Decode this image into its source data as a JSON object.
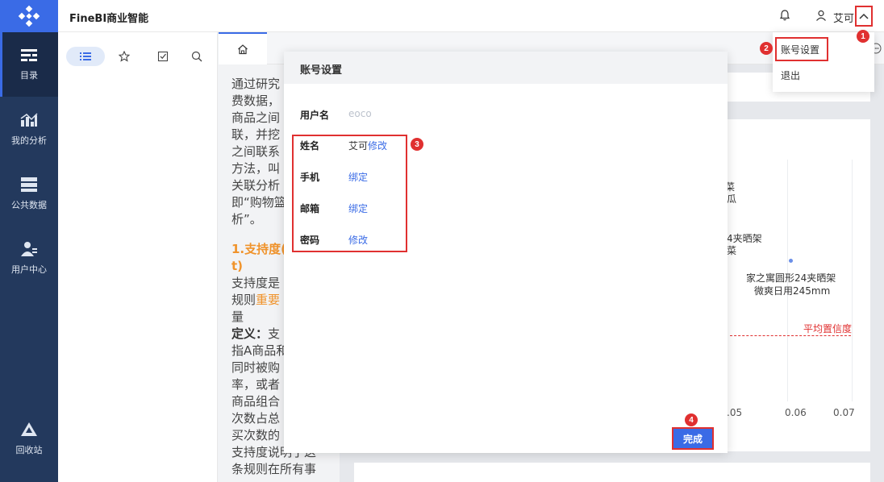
{
  "app": {
    "title": "FineBI商业智能"
  },
  "header": {
    "user_name": "艾可"
  },
  "nav": {
    "items": [
      {
        "label": "目录",
        "icon": "catalog-icon"
      },
      {
        "label": "我的分析",
        "icon": "my-analysis-icon"
      },
      {
        "label": "公共数据",
        "icon": "public-data-icon"
      },
      {
        "label": "用户中心",
        "icon": "user-center-icon"
      },
      {
        "label": "回收站",
        "icon": "recycle-bin-icon"
      }
    ]
  },
  "dropdown": {
    "items": [
      "账号设置",
      "退出"
    ]
  },
  "dialog": {
    "title": "账号设置",
    "username_label": "用户名",
    "username_value": "eoco",
    "name_label": "姓名",
    "name_value": "艾可",
    "name_action": "修改",
    "phone_label": "手机",
    "phone_action": "绑定",
    "email_label": "邮箱",
    "email_action": "绑定",
    "password_label": "密码",
    "password_action": "修改",
    "done_label": "完成"
  },
  "badges": [
    "1",
    "2",
    "3",
    "4"
  ],
  "doc": {
    "p1": "通过研究\n费数据，\n商品之间\n联，并挖\n之间联系\n方法，叫\n关联分析\n即“购物篮\n析”。",
    "heading": "1.支持度(\nt)",
    "p2a": "支持度是\n规则",
    "p2hl": "重要",
    "p2b": "\n量",
    "def_label": "定义：",
    "p3": "支\n指A商品和\n同时被购\n率，或者\n商品组合\n次数占总\n买次数的",
    "p4": "支持度说明了这\n条规则在所有事"
  },
  "chart": {
    "labels": [
      "菜",
      "瓜",
      "4夹晒架",
      "菜",
      "家之寓圆形24夹晒架",
      "微爽日用245mm"
    ],
    "avg_label": "平均置信度",
    "ticks": [
      ".05",
      "0.06",
      "0.07"
    ]
  }
}
